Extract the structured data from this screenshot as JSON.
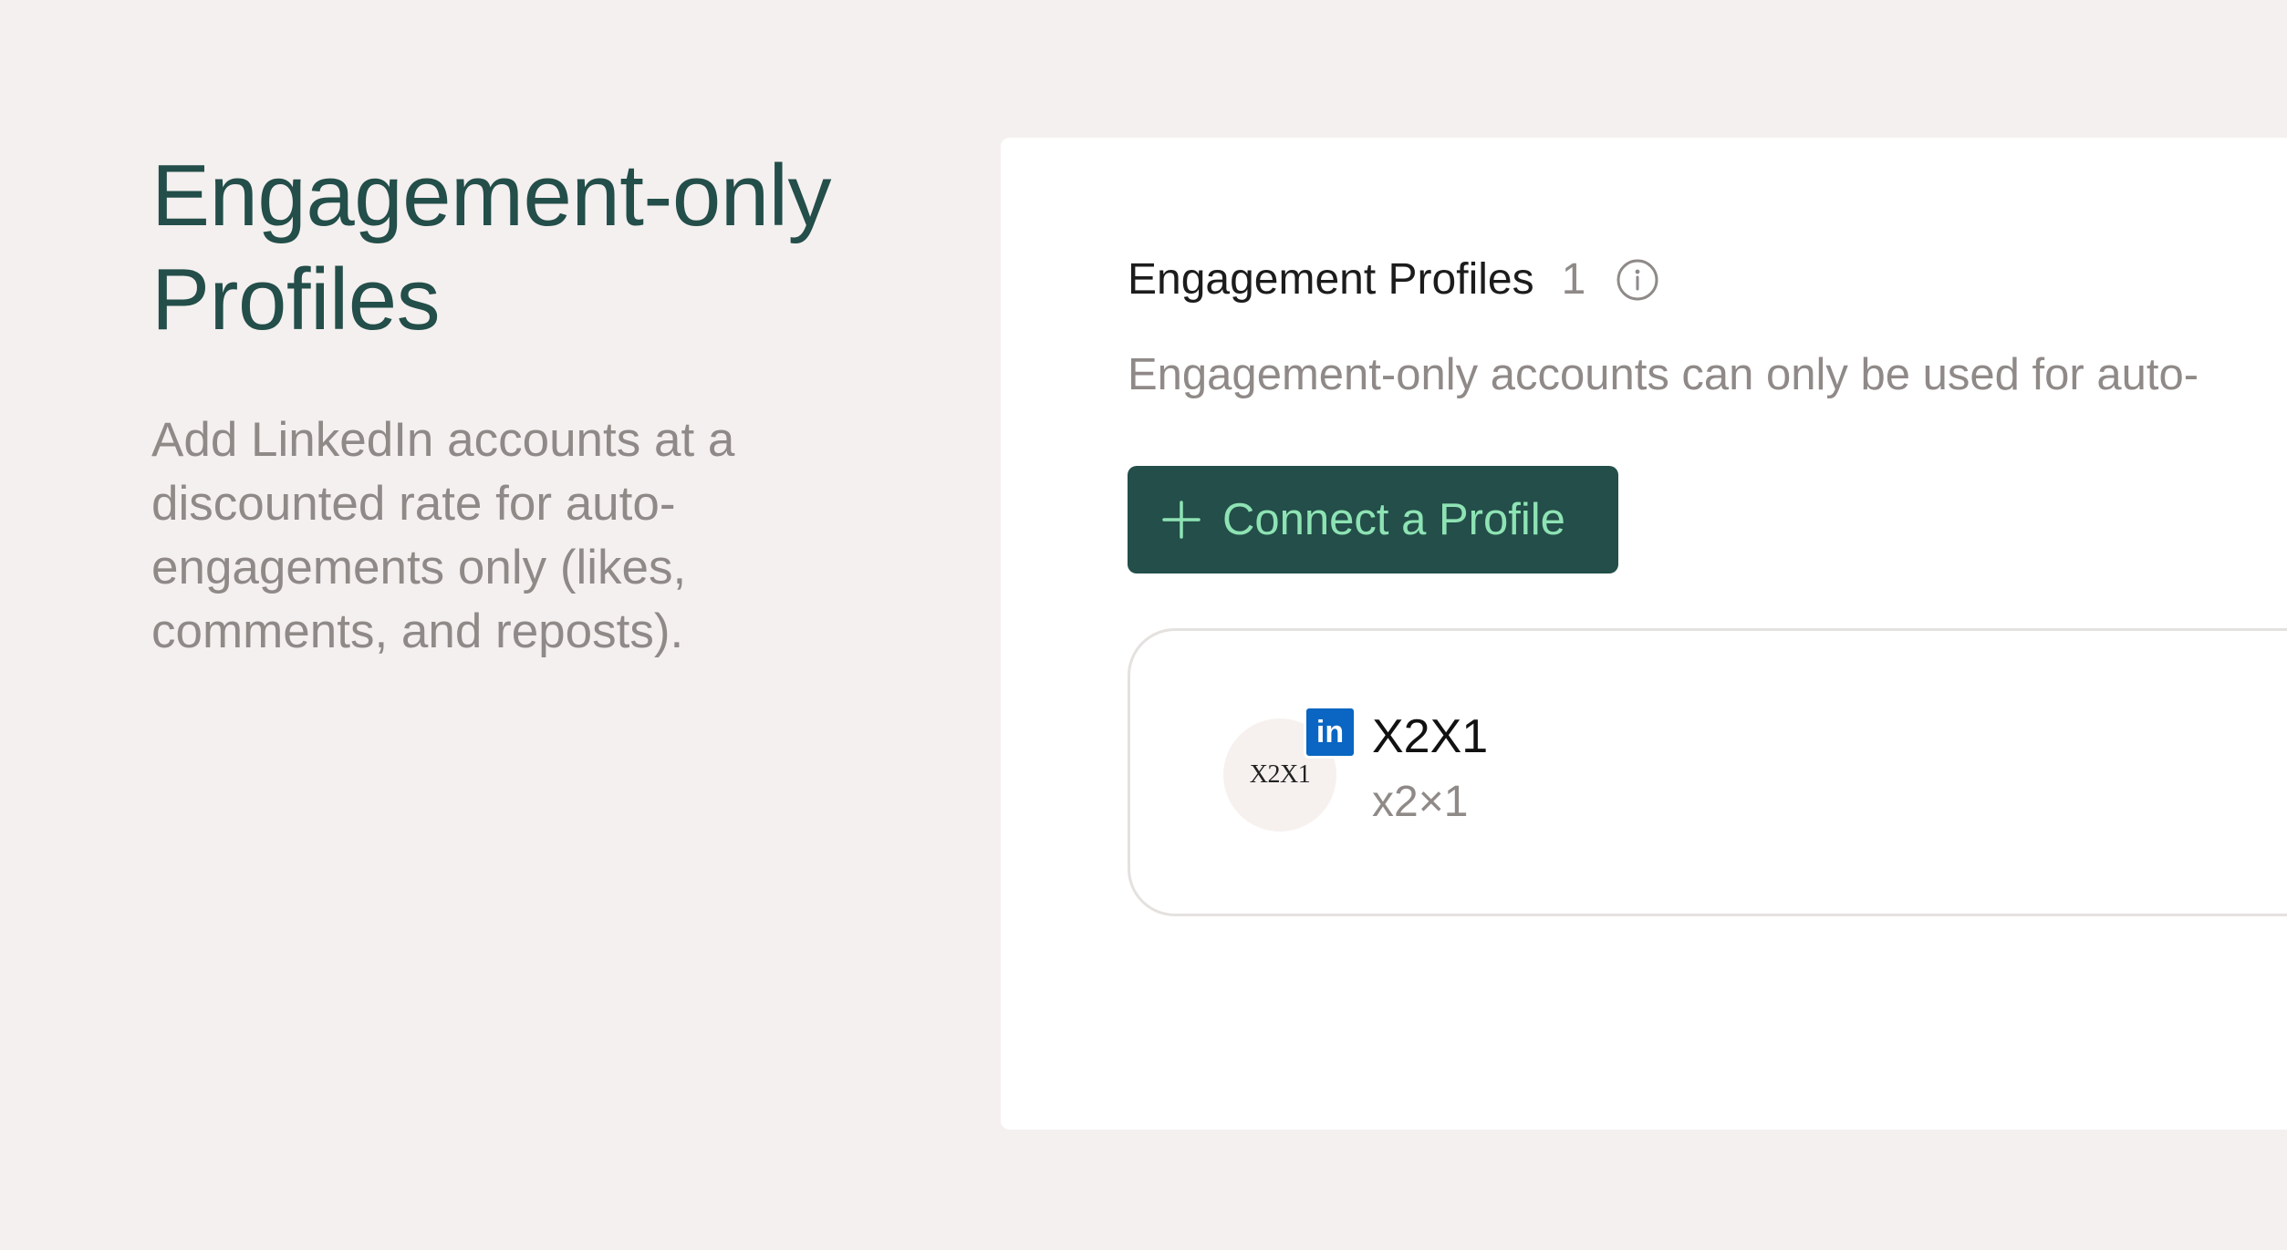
{
  "hero": {
    "title_line1": "Engagement-only",
    "title_line2": "Profiles",
    "description": "Add LinkedIn accounts at a discounted rate for auto-engagements only (likes, comments, and reposts)."
  },
  "section": {
    "title": "Engagement Profiles",
    "count": "1",
    "info_icon": "info-icon",
    "description": "Engagement-only accounts can only be used for auto-"
  },
  "connect_button": {
    "icon": "plus-icon",
    "label": "Connect a Profile"
  },
  "profiles": [
    {
      "avatar_text": "X2X1",
      "badge_icon": "linkedin-icon",
      "badge_text": "in",
      "name": "X2X1",
      "handle": "x2×1"
    }
  ],
  "colors": {
    "background": "#f4f0ef",
    "brand_dark": "#234e49",
    "button_text": "#8ee3b4",
    "muted_text": "#8f8a88",
    "linkedin_blue": "#0a66c2"
  }
}
